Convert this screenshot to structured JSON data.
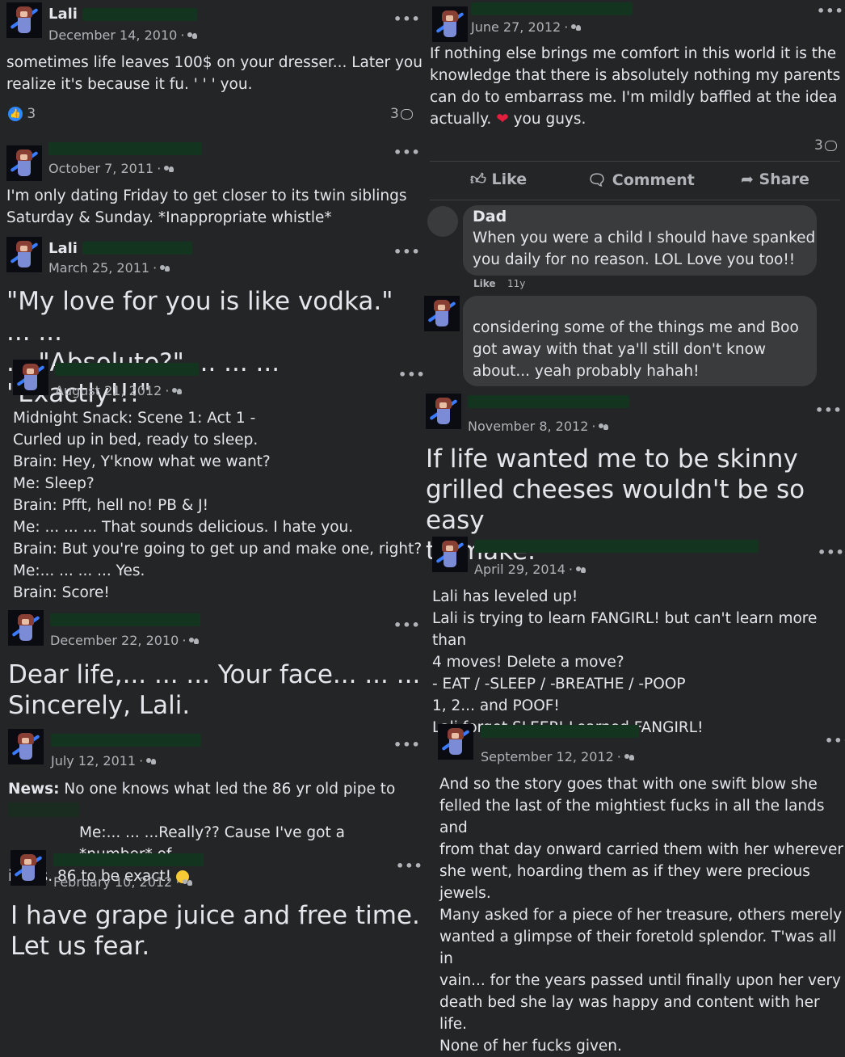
{
  "colors": {
    "background": "#242526",
    "text": "#e4e6eb",
    "muted": "#b0b3b8",
    "link_blue": "#2d88ff",
    "redaction": "#13341f",
    "heart": "#e41e3f"
  },
  "posts_left": [
    {
      "name": "Lali",
      "date": "December 14, 2010",
      "text_lines": [
        "sometimes life leaves 100$ on your dresser... Later you",
        "realize it's because it fu. ' ' ' you."
      ],
      "reactions": "3",
      "comments": "3"
    },
    {
      "name": "",
      "date": "October 7, 2011",
      "text_lines": [
        "I'm only dating Friday to get closer to its twin siblings",
        "Saturday & Sunday. *Inappropriate whistle*"
      ]
    },
    {
      "name": "Lali",
      "date": "March 25, 2011",
      "text_lines": [
        "\"My love for you is like vodka.\" ... ...",
        "... \"Absolute?\" ... ... ... \"Exactly!!!\""
      ]
    },
    {
      "name": "",
      "date": "August 21, 2012",
      "text_lines": [
        "Midnight Snack: Scene 1: Act 1 -",
        "Curled up in bed, ready to sleep.",
        "Brain: Hey, Y'know what we want?",
        "Me: Sleep?",
        "Brain: Pfft, hell no! PB & J!",
        "Me: ... ... ... That sounds delicious. I hate you.",
        "Brain: But you're going to get up and make one, right?",
        "Me:... ... ... ... Yes.",
        "Brain: Score!"
      ]
    },
    {
      "name": "",
      "date": "December 22, 2010",
      "text_lines": [
        "Dear life,... ... ... Your face... ... ...",
        "Sincerely, Lali."
      ]
    },
    {
      "name": "",
      "date": "July 12, 2011",
      "news_label": "News:",
      "text_lines": [
        "No one knows what led the 86 yr old pipe to burst",
        "Me:... ... ...Really?? Cause I've got a *number* of",
        "ideas. 86 to be exact!"
      ]
    },
    {
      "name": "",
      "date": "February 10, 2012",
      "text_lines": [
        "I have grape juice and free time.",
        "Let us fear."
      ]
    }
  ],
  "posts_right": [
    {
      "date": "June 27, 2012",
      "text_lines": [
        "If nothing else brings me comfort in this world it is the",
        "knowledge that there is absolutely nothing my parents",
        "can do to embarrass me. I'm mildly baffled at the idea",
        "actually.",
        "you guys."
      ],
      "comments": "3",
      "actions": {
        "like": "Like",
        "comment": "Comment",
        "share": "Share"
      }
    },
    {
      "commenter": "Dad",
      "comment_lines": [
        "When you were a child I should have spanked",
        "you daily for no reason. LOL Love you too!!"
      ],
      "like_label": "Like",
      "age": "11y"
    },
    {
      "reply_lines": [
        "considering some of the things me and Boo",
        "got away with that ya'll still don't know",
        "about... yeah probably hahah!"
      ]
    },
    {
      "date": "November 8, 2012",
      "text_lines": [
        "If life wanted me to be skinny",
        "grilled cheeses wouldn't be so easy",
        "to make."
      ]
    },
    {
      "date": "April 29, 2014",
      "text_lines": [
        "Lali has leveled up!",
        "Lali is trying to learn FANGIRL! but can't learn more than",
        "4 moves! Delete a move?",
        "- EAT / -SLEEP / -BREATHE / -POOP",
        "1, 2... and POOF!",
        "Lali forgot SLEEP! Learned FANGIRL!"
      ]
    },
    {
      "date": "September 12, 2012",
      "text_lines": [
        "And so the story goes that with one swift blow she",
        "felled the last of the mightiest fucks in all the lands and",
        "from that day onward carried them with her wherever",
        "she went, hoarding them as if they were precious jewels.",
        "Many asked for a piece of her treasure, others merely",
        "wanted a glimpse of their foretold splendor. T'was all in",
        "vain... for the years passed until finally upon her very",
        "death bed she lay was happy and content with her life.",
        "None of her fucks given."
      ]
    }
  ],
  "more_label": "•••",
  "icons": [
    "audience-friends-icon",
    "more-options-icon",
    "like-icon",
    "comment-icon",
    "share-icon",
    "heart-emoji",
    "tongue-emoji"
  ]
}
